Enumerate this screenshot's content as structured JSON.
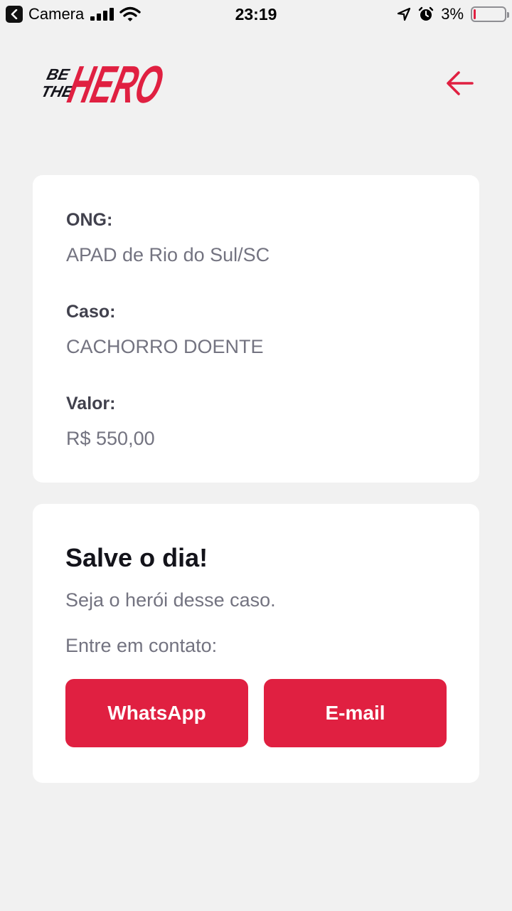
{
  "status_bar": {
    "back_app": "Camera",
    "time": "23:19",
    "battery": "3%",
    "battery_level": 0.03
  },
  "header": {
    "logo_text_small_1": "BE",
    "logo_text_small_2": "THE",
    "logo_text_big": "HERO"
  },
  "incident": {
    "ong_label": "ONG:",
    "ong_value": "APAD de Rio do Sul/SC",
    "case_label": "Caso:",
    "case_value": "CACHORRO DOENTE",
    "value_label": "Valor:",
    "value_value": "R$ 550,00"
  },
  "contact": {
    "title": "Salve o dia!",
    "description": "Seja o herói desse caso.",
    "prompt": "Entre em contato:",
    "whatsapp_label": "WhatsApp",
    "email_label": "E-mail"
  },
  "colors": {
    "accent": "#E02041",
    "background": "#F1F1F1",
    "label": "#41414D",
    "value": "#737380"
  }
}
